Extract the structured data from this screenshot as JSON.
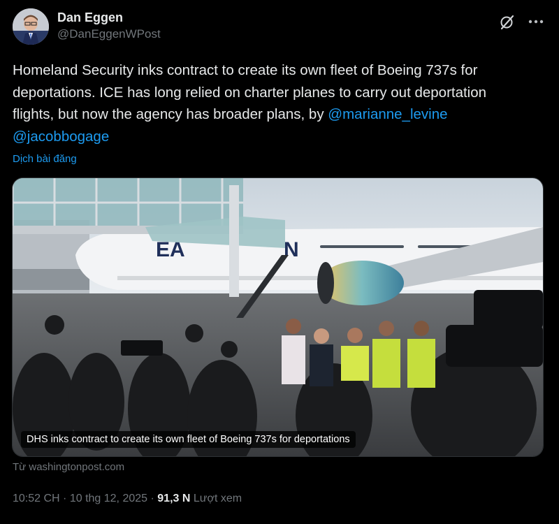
{
  "author": {
    "display_name": "Dan Eggen",
    "handle": "@DanEggenWPost"
  },
  "tweet": {
    "text_line1": "Homeland Security inks contract to create its own fleet of Boeing 737s for",
    "text_line2": "deportations. ICE has long relied on charter planes to carry out deportation",
    "text_line3": "flights, but now the agency has broader plans, by ",
    "mention1": "@marianne_levine",
    "mention2": "@jacobbogage",
    "translate_label": "Dịch bài đăng"
  },
  "card": {
    "caption": "DHS inks contract to create its own fleet of Boeing 737s for deportations",
    "source": "Từ washingtonpost.com"
  },
  "meta": {
    "time": "10:52 CH",
    "separator": "·",
    "date": "10 thg 12, 2025",
    "views_count": "91,3 N",
    "views_label": "Lượt xem"
  },
  "colors": {
    "background": "#000000",
    "text": "#e7e9ea",
    "muted": "#71767b",
    "link": "#1d9bf0"
  },
  "icons": [
    "grok-icon",
    "more-icon"
  ]
}
